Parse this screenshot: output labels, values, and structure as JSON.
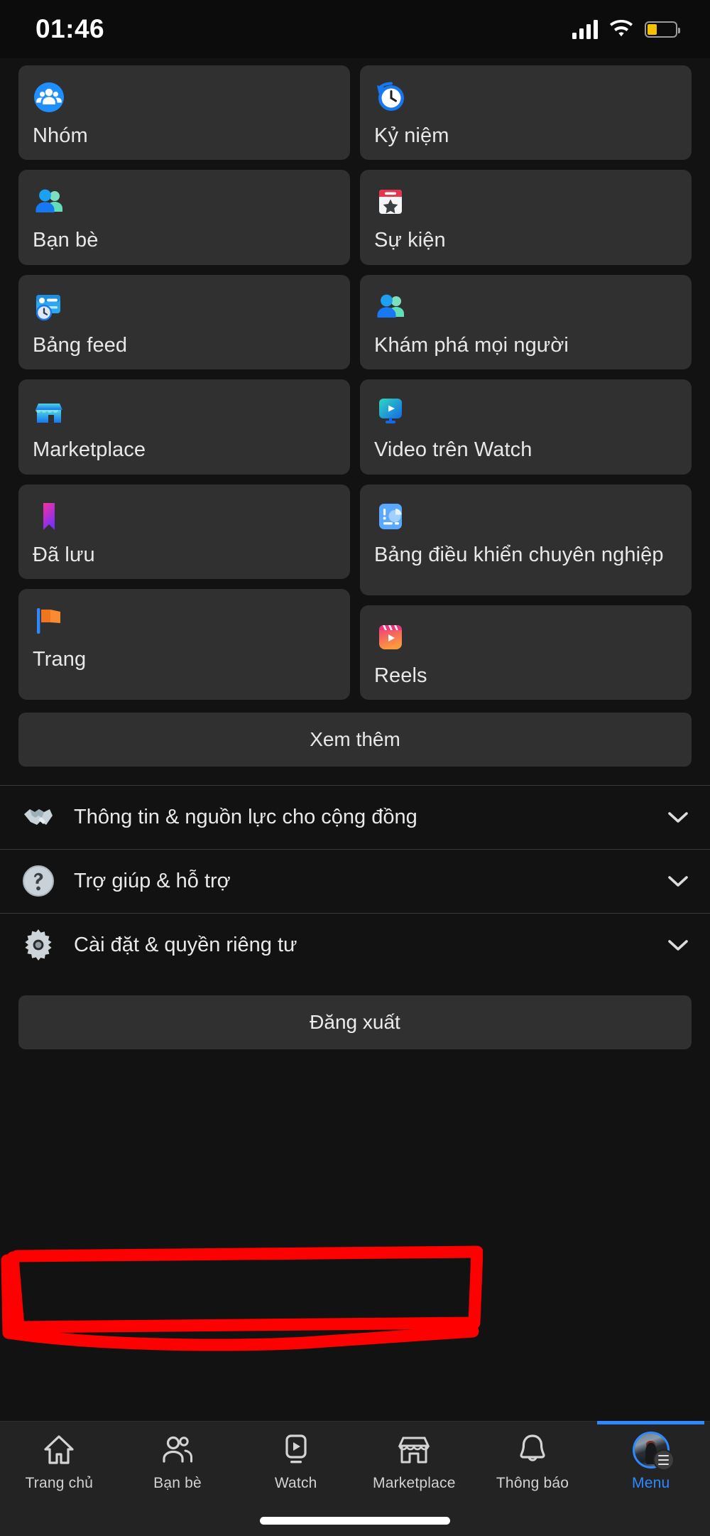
{
  "statusbar": {
    "time": "01:46",
    "signal_icon": "cellular-signal-icon",
    "wifi_icon": "wifi-icon",
    "battery_icon": "battery-low-icon",
    "battery_color": "#f2c200"
  },
  "shortcuts": {
    "left_column": [
      {
        "label": "Nhóm",
        "icon": "groups-icon"
      },
      {
        "label": "Bạn bè",
        "icon": "friends-icon"
      },
      {
        "label": "Bảng feed",
        "icon": "feeds-icon"
      },
      {
        "label": "Marketplace",
        "icon": "marketplace-icon"
      },
      {
        "label": "Đã lưu",
        "icon": "saved-bookmark-icon"
      },
      {
        "label": "Trang",
        "icon": "pages-flag-icon"
      }
    ],
    "right_column": [
      {
        "label": "Kỷ niệm",
        "icon": "memories-clock-icon"
      },
      {
        "label": "Sự kiện",
        "icon": "events-calendar-icon"
      },
      {
        "label": "Khám phá mọi người",
        "icon": "discover-people-icon"
      },
      {
        "label": "Video trên Watch",
        "icon": "watch-video-icon"
      },
      {
        "label": "Bảng điều khiển chuyên nghiệp",
        "icon": "professional-dashboard-icon"
      },
      {
        "label": "Reels",
        "icon": "reels-icon"
      }
    ],
    "see_more_label": "Xem thêm"
  },
  "menu_list": [
    {
      "label": "Thông tin & nguồn lực cho cộng đồng",
      "icon": "handshake-icon",
      "chevron": "chevron-down-icon"
    },
    {
      "label": "Trợ giúp & hỗ trợ",
      "icon": "help-question-icon",
      "chevron": "chevron-down-icon"
    },
    {
      "label": "Cài đặt & quyền riêng tư",
      "icon": "settings-gear-icon",
      "chevron": "chevron-down-icon",
      "highlighted": true
    }
  ],
  "logout": {
    "label": "Đăng xuất"
  },
  "tabbar": {
    "active_color": "#2e89ff",
    "items": [
      {
        "label": "Trang chủ",
        "icon": "home-icon",
        "active": false
      },
      {
        "label": "Bạn bè",
        "icon": "friends-outline-icon",
        "active": false
      },
      {
        "label": "Watch",
        "icon": "watch-play-icon",
        "active": false
      },
      {
        "label": "Marketplace",
        "icon": "marketplace-outline-icon",
        "active": false
      },
      {
        "label": "Thông báo",
        "icon": "bell-icon",
        "active": false
      },
      {
        "label": "Menu",
        "icon": "avatar-menu-icon",
        "active": true
      }
    ]
  },
  "annotation": {
    "color": "#ff0000",
    "target": "Cài đặt & quyền riêng tư",
    "shape": "hand-drawn-rectangle"
  }
}
